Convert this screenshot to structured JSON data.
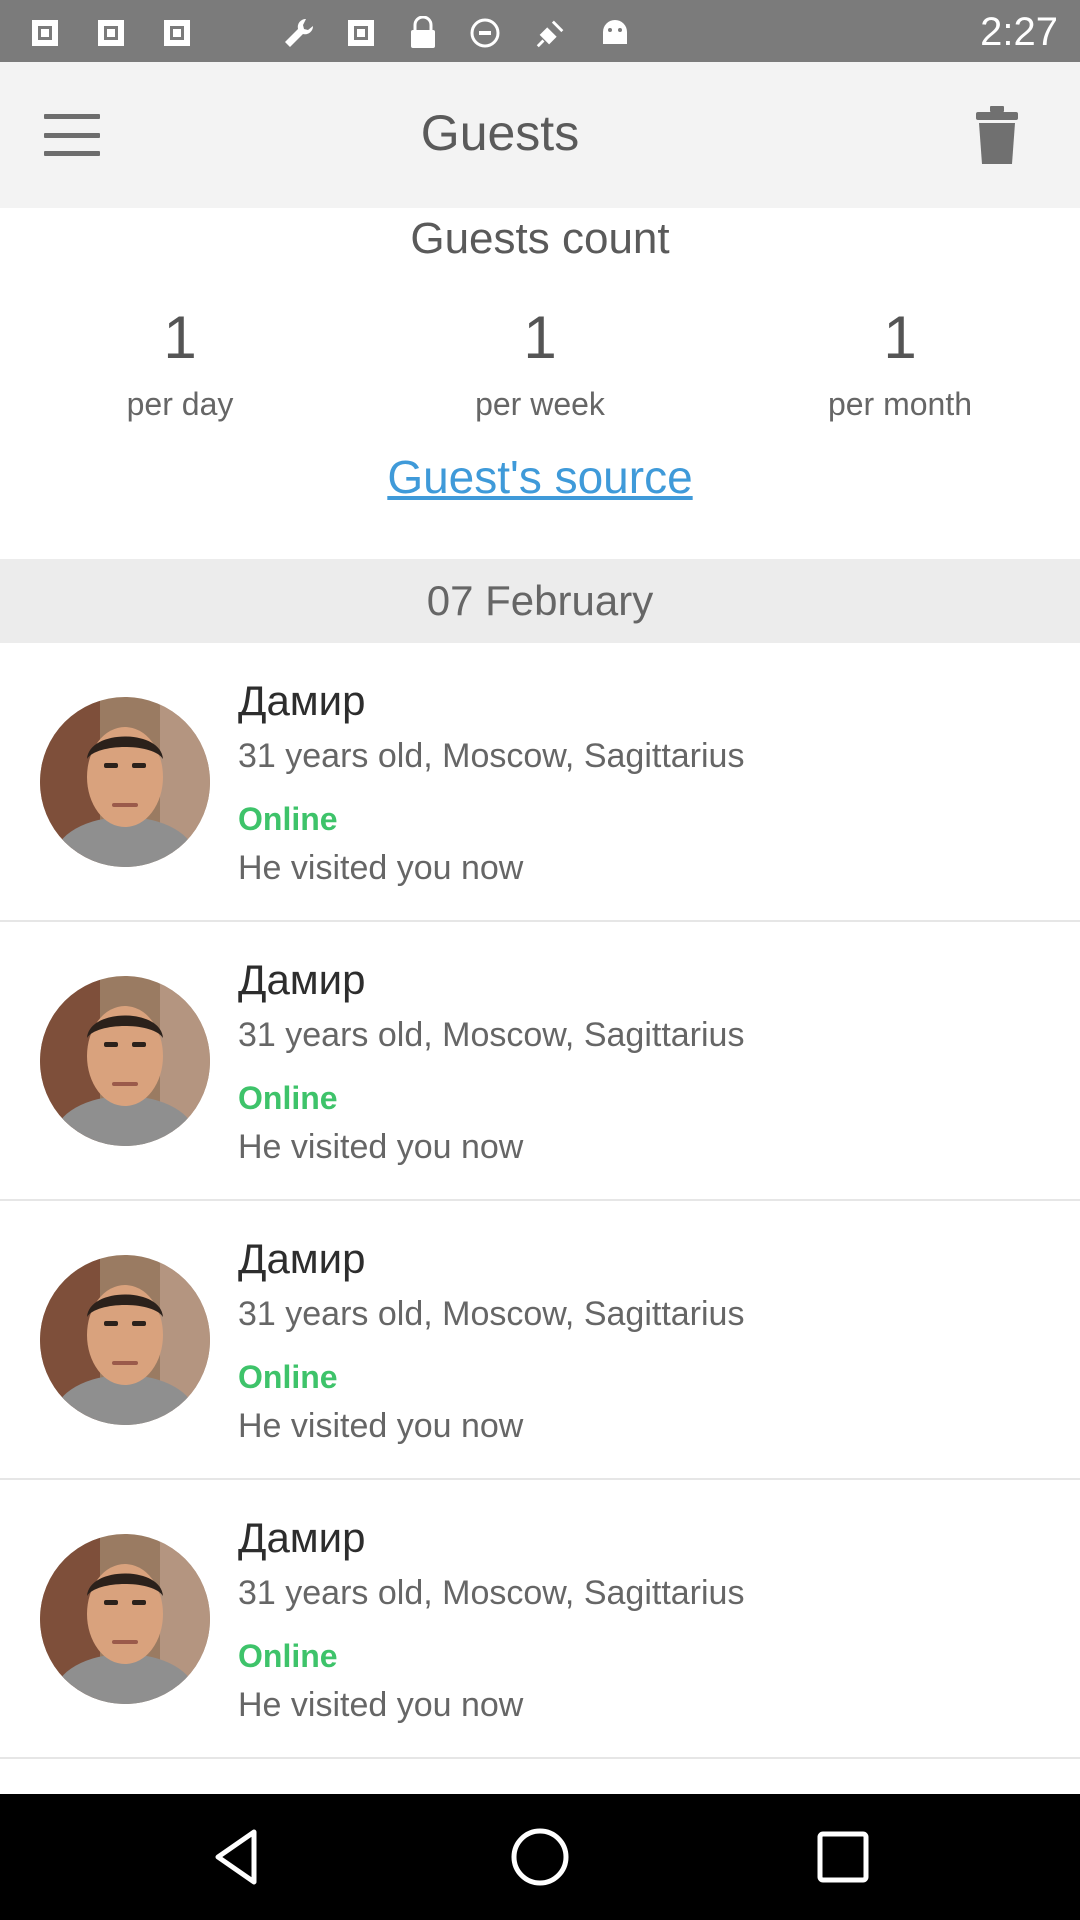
{
  "status_bar": {
    "time": "2:27",
    "icons": [
      "image-icon",
      "image-icon",
      "image-icon",
      "wrench-icon",
      "image-icon",
      "lock-icon",
      "blocked-icon",
      "fake-gps-icon",
      "android-icon"
    ]
  },
  "app_bar": {
    "title": "Guests",
    "menu_icon": "hamburger-menu-icon",
    "delete_icon": "trash-icon"
  },
  "counts": {
    "title": "Guests count",
    "items": [
      {
        "value": "1",
        "label": "per day"
      },
      {
        "value": "1",
        "label": "per week"
      },
      {
        "value": "1",
        "label": "per month"
      }
    ],
    "source_link": "Guest's source"
  },
  "date_header": "07 February",
  "guests": [
    {
      "name": "Дамир",
      "info": "31 years old, Moscow, Sagittarius",
      "status": "Online",
      "visit": "He visited you now"
    },
    {
      "name": "Дамир",
      "info": "31 years old, Moscow, Sagittarius",
      "status": "Online",
      "visit": "He visited you now"
    },
    {
      "name": "Дамир",
      "info": "31 years old, Moscow, Sagittarius",
      "status": "Online",
      "visit": "He visited you now"
    },
    {
      "name": "Дамир",
      "info": "31 years old, Moscow, Sagittarius",
      "status": "Online",
      "visit": "He visited you now"
    }
  ],
  "nav_bar": {
    "back_icon": "back-triangle-icon",
    "home_icon": "home-circle-icon",
    "recents_icon": "recents-square-icon"
  },
  "colors": {
    "status_bar": "#7b7b7b",
    "app_bar": "#f3f3f3",
    "link": "#3f9ad9",
    "online": "#3ec36a",
    "date_header": "#ececec"
  }
}
